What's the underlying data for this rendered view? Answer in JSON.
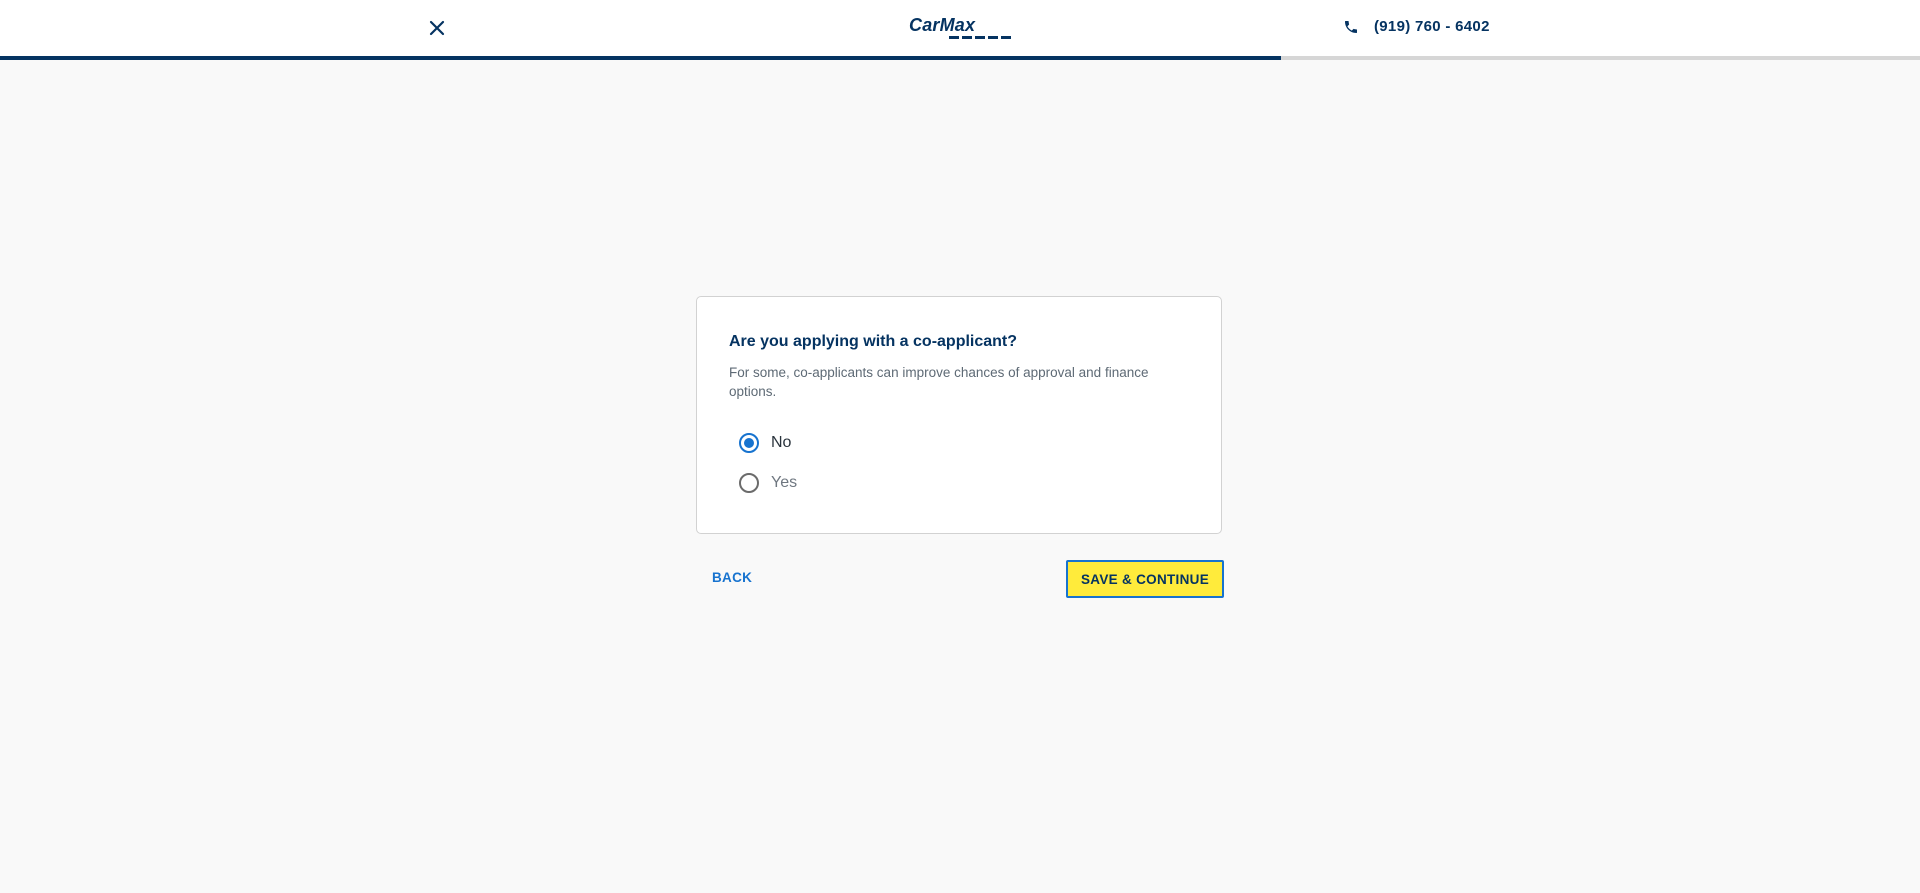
{
  "header": {
    "logo_text": "CarMax",
    "phone_number": "(919) 760 - 6402",
    "progress_fraction": 0.667
  },
  "form": {
    "question": "Are you applying with a co-applicant?",
    "subtext": "For some, co-applicants can improve chances of approval and finance options.",
    "options": [
      {
        "label": "No",
        "selected": true
      },
      {
        "label": "Yes",
        "selected": false
      }
    ]
  },
  "actions": {
    "back_label": "BACK",
    "save_label": "SAVE & CONTINUE"
  },
  "colors": {
    "brand_navy": "#053361",
    "accent_blue": "#1773cf",
    "cta_yellow": "#ffeb3b"
  }
}
